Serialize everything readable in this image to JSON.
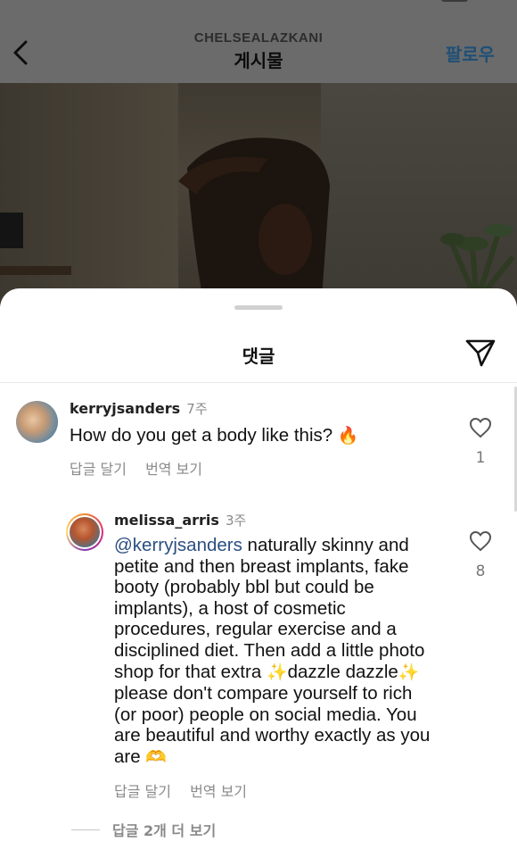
{
  "header": {
    "username": "CHELSEALAZKANI",
    "section": "게시물",
    "follow_label": "팔로우",
    "back_icon": "chevron-left-icon"
  },
  "sheet": {
    "title": "댓글",
    "share_icon": "paper-plane-icon"
  },
  "comments": [
    {
      "username": "kerryjsanders",
      "time": "7주",
      "text": "How do you get a body like this?",
      "emoji": "🔥",
      "reply_label": "답글 달기",
      "translate_label": "번역 보기",
      "likes": "1"
    },
    {
      "username": "melissa_arris",
      "time": "3주",
      "mention": "@kerryjsanders",
      "text_part1": " naturally skinny and petite and then breast implants, fake booty (probably bbl but could be implants), a host of cosmetic procedures, regular exercise and a disciplined diet. Then add a little photo shop for that extra ",
      "emoji_sparkle_1": "✨",
      "text_part2": "dazzle dazzle",
      "emoji_sparkle_2": "✨",
      "text_part3": " please don't compare yourself to rich (or poor) people on social media. You are beautiful and worthy exactly as you are ",
      "emoji_heart_hands": "🫶",
      "reply_label": "답글 달기",
      "translate_label": "번역 보기",
      "likes": "8"
    }
  ],
  "more_replies_label": "답글 2개 더 보기",
  "colors": {
    "mention": "#2b4f81",
    "follow": "#1f4f77",
    "muted_text": "#8a8a8a"
  }
}
